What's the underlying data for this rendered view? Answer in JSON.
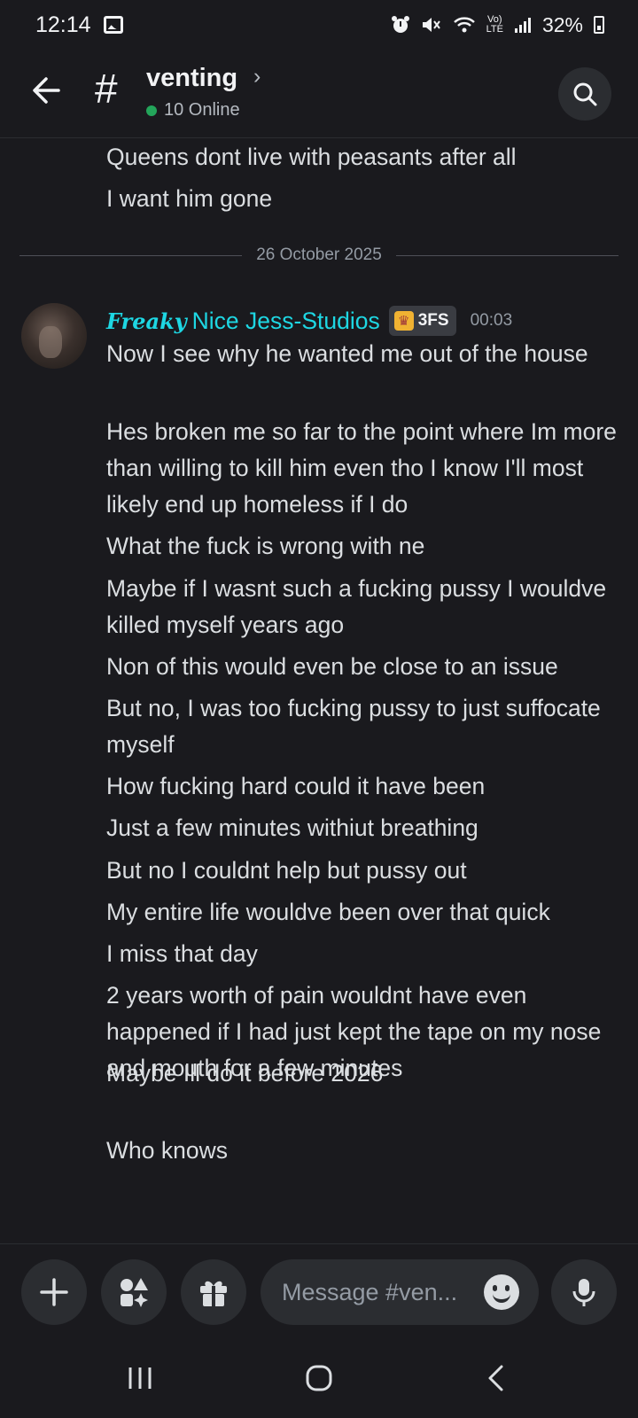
{
  "status_bar": {
    "time": "12:14",
    "battery": "32%",
    "network": "LTE",
    "icons": [
      "gallery-icon",
      "alarm-icon",
      "mute-icon",
      "wifi-icon",
      "volte-icon",
      "signal-icon",
      "battery-icon"
    ]
  },
  "header": {
    "channel_name": "venting",
    "online_count": "10 Online",
    "online_color": "#23a55a"
  },
  "messages": {
    "previous_lines": [
      "Queens dont live with peasants after all",
      "I want him gone"
    ],
    "date_divider": "26 October 2025",
    "group": {
      "author_prefix": "Freaky",
      "author_name": "Nice Jess-Studios",
      "author_color": "#1ed7e3",
      "tag": "3FS",
      "timestamp": "00:03",
      "lines": [
        "Now I see why he wanted me out of the house",
        "Hes broken me so far to the point where Im more than willing to kill him even tho I know I'll most likely end up homeless if I do",
        "What the fuck is wrong with ne",
        "Maybe if I wasnt such a fucking pussy I wouldve killed myself years ago",
        "Non of this would even be close to an issue",
        "But no, I was too fucking pussy to just suffocate myself",
        "How fucking hard could it have been",
        "Just a few minutes withiut breathing",
        "But no I couldnt help but pussy out",
        "My entire life wouldve been over that quick",
        "I miss that day",
        "2 years worth of pain wouldnt have even happened if I had just kept the tape on my nose and mouth for a few minutes",
        "Maybe Ill do it before 2026",
        "Who knows"
      ]
    }
  },
  "composer": {
    "placeholder": "Message #ven..."
  }
}
